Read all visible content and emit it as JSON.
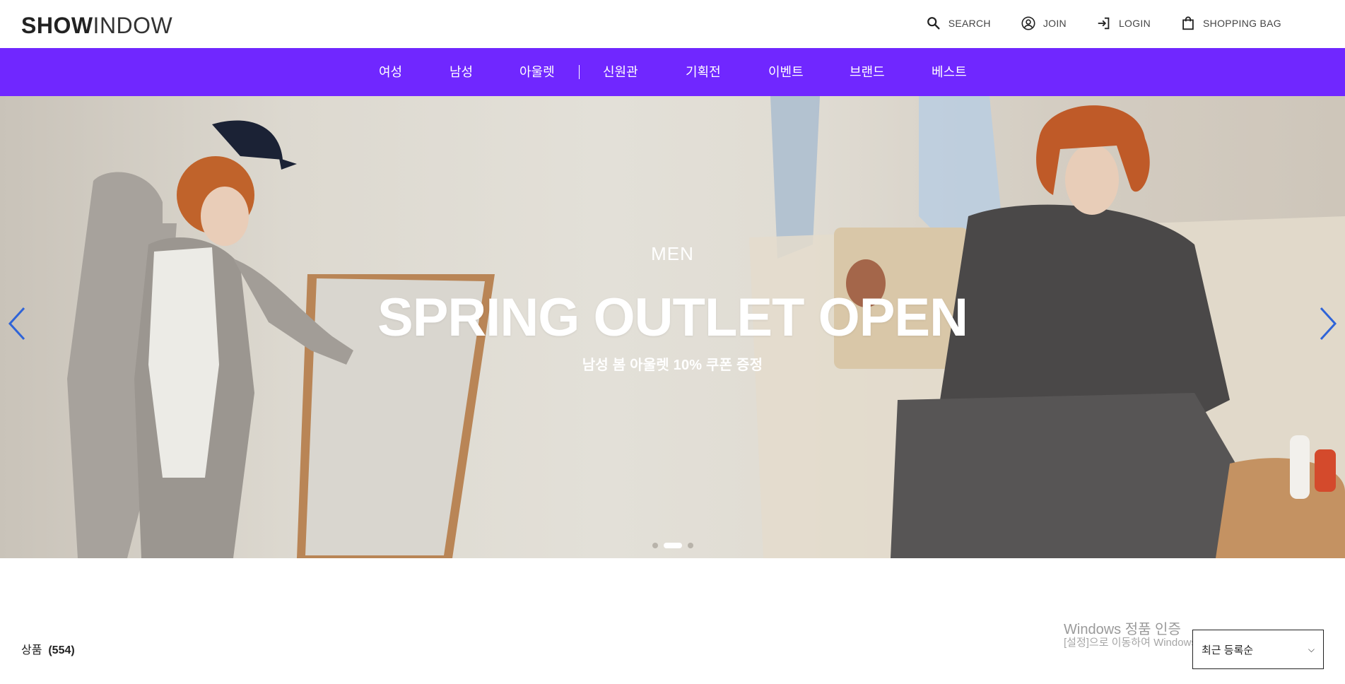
{
  "header": {
    "logo_bold": "SHOW",
    "logo_thin": "INDOW",
    "util": [
      {
        "label": "SEARCH",
        "icon": "search-icon"
      },
      {
        "label": "JOIN",
        "icon": "user-circle-icon"
      },
      {
        "label": "LOGIN",
        "icon": "login-icon"
      },
      {
        "label": "SHOPPING BAG",
        "icon": "shopping-bag-icon"
      }
    ]
  },
  "nav": {
    "background": "#7027ff",
    "items": [
      "여성",
      "남성",
      "아울렛",
      "신원관",
      "기획전",
      "이벤트",
      "브랜드",
      "베스트"
    ]
  },
  "hero": {
    "category": "MEN",
    "title": "SPRING OUTLET OPEN",
    "subtitle": "남성 봄 아울렛 10% 쿠폰 증정",
    "slides": 3,
    "active_slide": 2
  },
  "products": {
    "label": "상품",
    "count": "(554)",
    "sort_selected": "최근 등록순"
  },
  "watermark": {
    "line1": "Windows 정품 인증",
    "line2": "[설정]으로 이동하여 Windows를 정품 인증합니다."
  }
}
